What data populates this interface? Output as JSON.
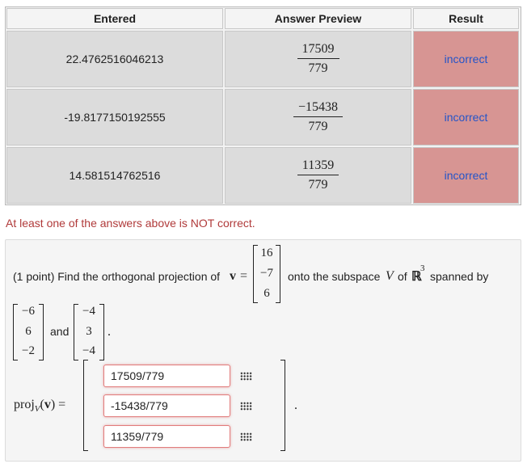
{
  "table": {
    "headers": [
      "Entered",
      "Answer Preview",
      "Result"
    ],
    "rows": [
      {
        "entered": "22.4762516046213",
        "preview_num": "17509",
        "preview_den": "779",
        "result": "incorrect"
      },
      {
        "entered": "-19.8177150192555",
        "preview_num": "−15438",
        "preview_den": "779",
        "result": "incorrect"
      },
      {
        "entered": "14.581514762516",
        "preview_num": "11359",
        "preview_den": "779",
        "result": "incorrect"
      }
    ]
  },
  "message": "At least one of the answers above is NOT correct.",
  "problem": {
    "prefix": "(1 point) Find the orthogonal projection of",
    "v_symbol": "v",
    "equals": "=",
    "v_vector": [
      "16",
      "−7",
      "6"
    ],
    "mid_text": "onto the subspace",
    "subspace": "V",
    "of_text": "of",
    "reals": "ℝ",
    "power": "3",
    "spanned_text": "spanned by",
    "u1": [
      "−6",
      "6",
      "−2"
    ],
    "and_text": "and",
    "u2": [
      "−4",
      "3",
      "−4"
    ],
    "period": ".",
    "proj_label": "proj",
    "proj_sub": "V",
    "proj_arg_open": "(",
    "proj_arg": "v",
    "proj_arg_close": ")",
    "proj_equals": "=",
    "answers": [
      "17509/779",
      "-15438/779",
      "11359/779"
    ],
    "end_period": "."
  },
  "icons": {
    "matrix_entry": "grid-icon"
  },
  "colors": {
    "incorrect_bg": "#d79593",
    "incorrect_text": "#2454c8",
    "warning_text": "#b03a3a",
    "input_border": "#e17b7b"
  }
}
